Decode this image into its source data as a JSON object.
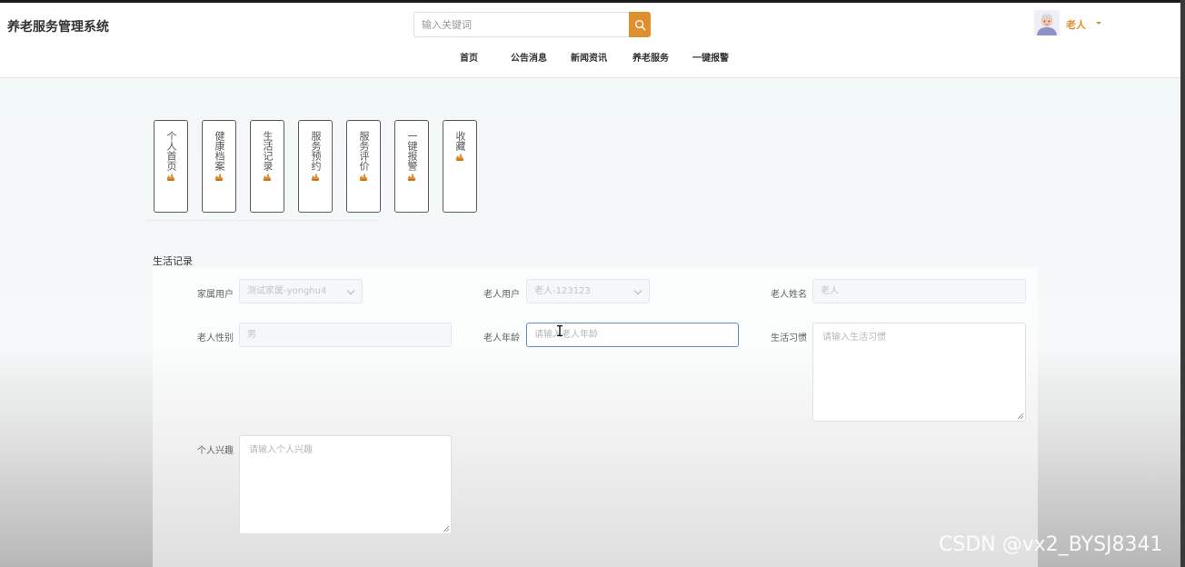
{
  "header": {
    "site_title": "养老服务管理系统",
    "search": {
      "placeholder": "输入关键词"
    },
    "nav": [
      {
        "label": "首页"
      },
      {
        "label": "公告消息"
      },
      {
        "label": "新闻资讯"
      },
      {
        "label": "养老服务"
      },
      {
        "label": "一键报警"
      }
    ],
    "user": {
      "name": "老人"
    }
  },
  "center_menu": [
    {
      "label": "个人首页"
    },
    {
      "label": "健康档案"
    },
    {
      "label": "生活记录"
    },
    {
      "label": "服务预约"
    },
    {
      "label": "服务评价"
    },
    {
      "label": "一键报警"
    },
    {
      "label": "收藏"
    }
  ],
  "form": {
    "section_title": "生活记录",
    "family_user": {
      "label": "家属用户",
      "value": "测试家属-yonghu4"
    },
    "elder_user": {
      "label": "老人用户",
      "value": "老人-123123"
    },
    "elder_name": {
      "label": "老人姓名",
      "value": "老人"
    },
    "elder_gender": {
      "label": "老人性别",
      "value": "男"
    },
    "elder_age": {
      "label": "老人年龄",
      "placeholder": "请输入老人年龄"
    },
    "living_habits": {
      "label": "生活习惯",
      "placeholder": "请输入生活习惯"
    },
    "hobbies": {
      "label": "个人兴趣",
      "placeholder": "请输入个人兴趣"
    }
  },
  "watermark": "CSDN @vx2_BYSJ8341",
  "colors": {
    "accent": "#e08f2e",
    "focus_border": "#5b8bd0"
  }
}
